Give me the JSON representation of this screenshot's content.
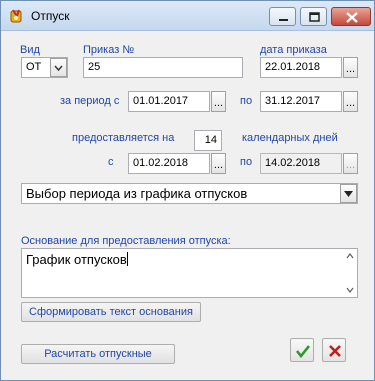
{
  "window": {
    "title": "Отпуск"
  },
  "form": {
    "vid": {
      "label": "Вид",
      "value": "ОТ"
    },
    "prikaz": {
      "label": "Приказ №",
      "value": "25"
    },
    "data_prikaza": {
      "label": "дата приказа",
      "value": "22.01.2018",
      "button": "..."
    },
    "period_from": {
      "label": "за период с",
      "value": "01.01.2017",
      "button": "..."
    },
    "period_to": {
      "label": "по",
      "value": "31.12.2017",
      "button": "..."
    },
    "days": {
      "label_before": "предоставляется на",
      "value": "14",
      "label_after": "календарных дней"
    },
    "leave_from": {
      "label": "с",
      "value": "01.02.2018",
      "button": "..."
    },
    "leave_to": {
      "label": "по",
      "value": "14.02.2018",
      "button": "..."
    },
    "schedule_select": {
      "value": "Выбор периода из графика отпусков"
    },
    "basis": {
      "label": "Основание для предоставления отпуска:",
      "value": "График отпусков"
    }
  },
  "buttons": {
    "generate_basis": "Сформировать текст основания",
    "calculate": "Расчитать отпускные"
  },
  "colors": {
    "label": "#2046a8",
    "ok": "#2a9a2a",
    "cancel": "#c0201c"
  }
}
